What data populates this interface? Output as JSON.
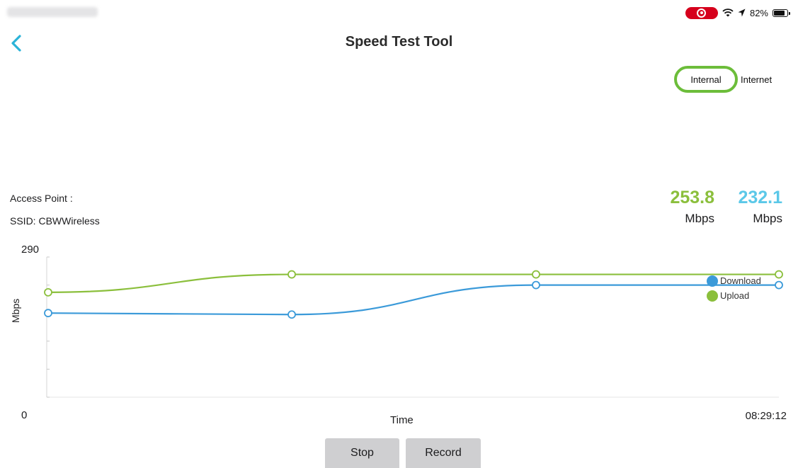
{
  "status_bar": {
    "battery": "82%"
  },
  "header": {
    "title": "Speed Test Tool"
  },
  "tabs": {
    "internal": "Internal",
    "internet": "Internet",
    "selected": "Internal"
  },
  "info": {
    "access_point": "Access Point :",
    "ssid": "SSID: CBWWireless"
  },
  "speeds": {
    "upload": {
      "value": "253.8",
      "unit": "Mbps",
      "color": "#8bbf3c"
    },
    "download": {
      "value": "232.1",
      "unit": "Mbps",
      "color": "#5bc8e8"
    }
  },
  "chart_data": {
    "type": "line",
    "ymin_label": "0",
    "ymax_label": "290",
    "ylim": [
      0,
      290
    ],
    "ylabel": "Mbps",
    "xlabel": "Time",
    "x_end_label": "08:29:12",
    "grid": false,
    "legend": "right",
    "series": [
      {
        "name": "Download",
        "color": "#3b9ad9",
        "values": [
          174,
          171,
          232,
          232
        ]
      },
      {
        "name": "Upload",
        "color": "#8bbf3c",
        "values": [
          217,
          254,
          254,
          254
        ]
      }
    ]
  },
  "buttons": {
    "stop": "Stop",
    "record": "Record"
  },
  "icons": {
    "back": "chevron-left-icon",
    "record_indicator": "screen-record-icon",
    "wifi": "wifi-icon",
    "location": "location-arrow-icon",
    "battery": "battery-icon"
  },
  "colors": {
    "accent": "#2bb3d8",
    "highlight": "#6cbd3a"
  }
}
